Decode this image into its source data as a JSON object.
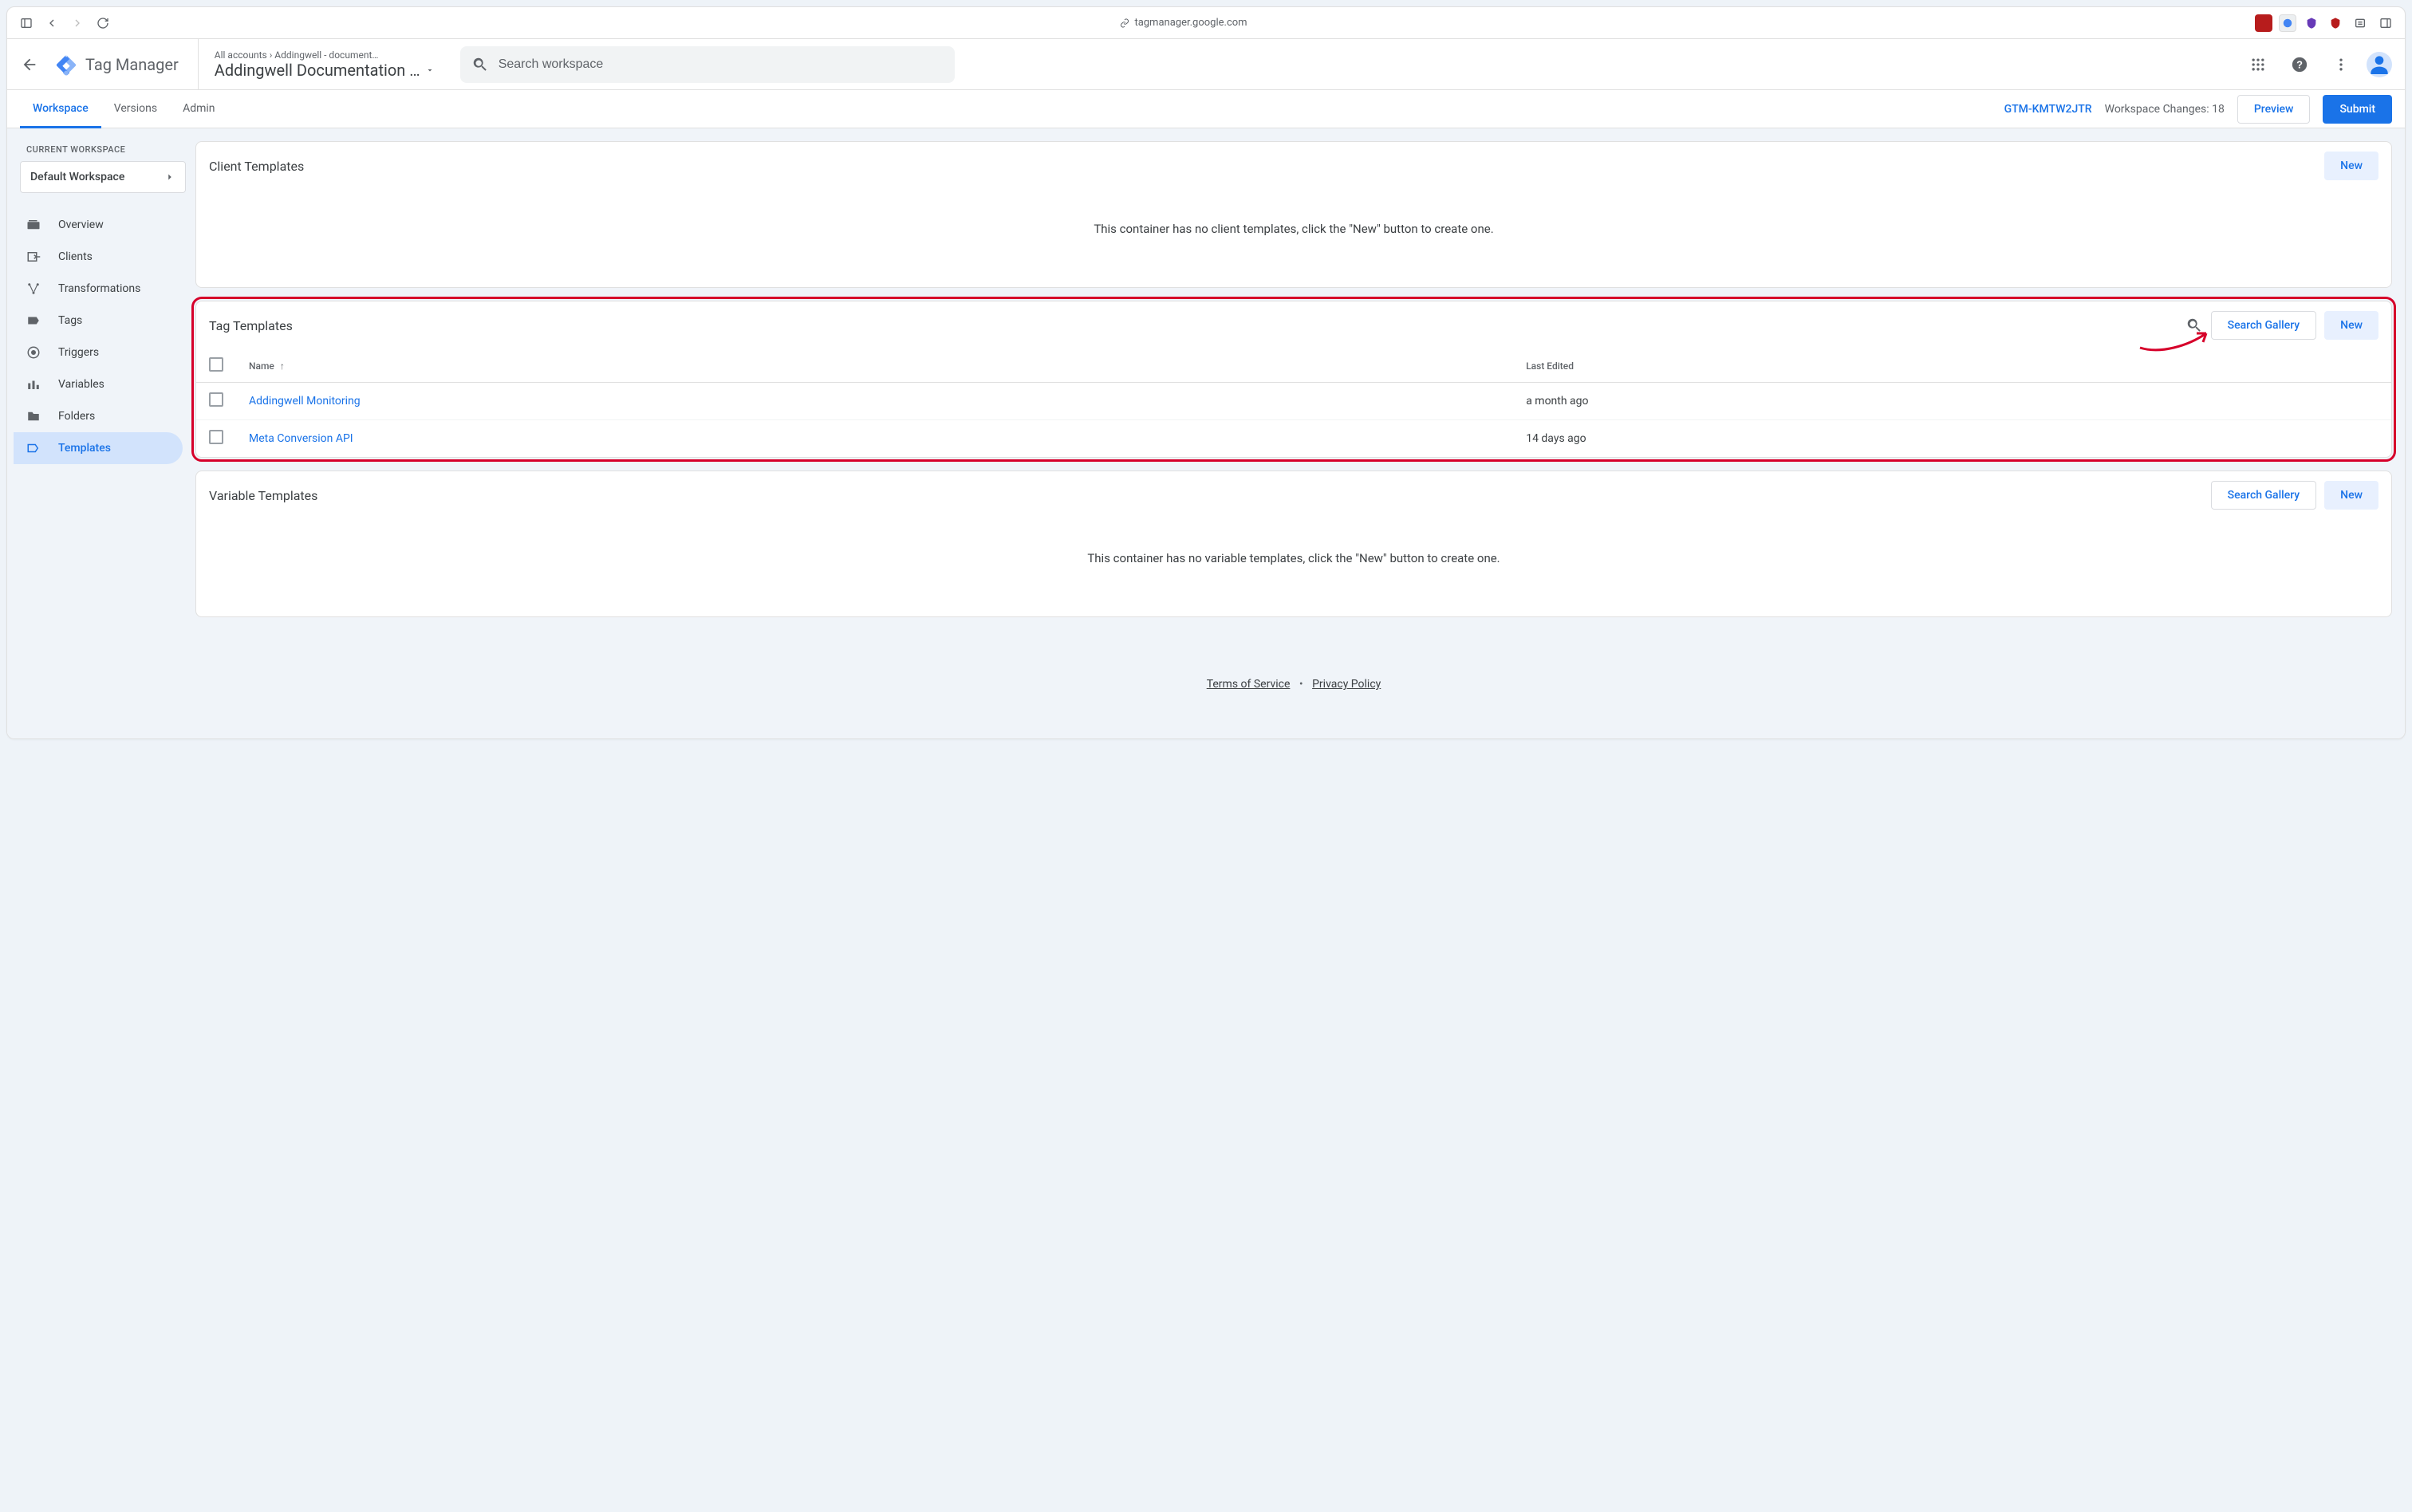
{
  "browser": {
    "url": "tagmanager.google.com"
  },
  "header": {
    "product": "Tag Manager",
    "breadcrumb_all": "All accounts",
    "breadcrumb_account": "Addingwell - document…",
    "container_name": "Addingwell Documentation …",
    "search_placeholder": "Search workspace"
  },
  "tabs": {
    "workspace": "Workspace",
    "versions": "Versions",
    "admin": "Admin"
  },
  "header_right": {
    "container_id": "GTM-KMTW2JTR",
    "changes_label": "Workspace Changes: 18",
    "preview": "Preview",
    "submit": "Submit"
  },
  "sidebar": {
    "current_workspace_label": "CURRENT WORKSPACE",
    "workspace_name": "Default Workspace",
    "items": [
      {
        "label": "Overview",
        "icon": "overview"
      },
      {
        "label": "Clients",
        "icon": "clients"
      },
      {
        "label": "Transformations",
        "icon": "transformations"
      },
      {
        "label": "Tags",
        "icon": "tags"
      },
      {
        "label": "Triggers",
        "icon": "triggers"
      },
      {
        "label": "Variables",
        "icon": "variables"
      },
      {
        "label": "Folders",
        "icon": "folders"
      },
      {
        "label": "Templates",
        "icon": "templates"
      }
    ]
  },
  "client_templates": {
    "title": "Client Templates",
    "new": "New",
    "empty": "This container has no client templates, click the \"New\" button to create one."
  },
  "tag_templates": {
    "title": "Tag Templates",
    "search_gallery": "Search Gallery",
    "new": "New",
    "col_name": "Name",
    "col_edited": "Last Edited",
    "rows": [
      {
        "name": "Addingwell Monitoring",
        "edited": "a month ago"
      },
      {
        "name": "Meta Conversion API",
        "edited": "14 days ago"
      }
    ]
  },
  "variable_templates": {
    "title": "Variable Templates",
    "search_gallery": "Search Gallery",
    "new": "New",
    "empty": "This container has no variable templates, click the \"New\" button to create one."
  },
  "footer": {
    "tos": "Terms of Service",
    "privacy": "Privacy Policy"
  }
}
